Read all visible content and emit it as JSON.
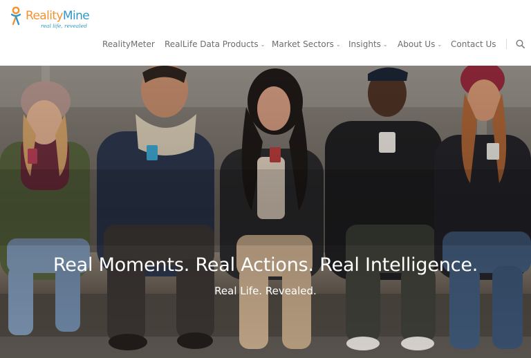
{
  "brand": {
    "name_part1": "Reality",
    "name_part2": "Mine",
    "tagline": "real life, revealed",
    "colors": {
      "orange": "#f2932f",
      "blue": "#2e97c5"
    }
  },
  "nav": {
    "items": [
      {
        "label": "RealityMeter",
        "has_dropdown": false
      },
      {
        "label": "RealLife Data Products",
        "has_dropdown": true
      },
      {
        "label": "Market Sectors",
        "has_dropdown": true
      },
      {
        "label": "Insights",
        "has_dropdown": true
      },
      {
        "label": "About Us",
        "has_dropdown": true
      },
      {
        "label": "Contact Us",
        "has_dropdown": false
      }
    ],
    "dropdown_icon": "chevron-down-icon",
    "search_icon": "search-icon"
  },
  "hero": {
    "headline": "Real Moments. Real Actions. Real Intelligence.",
    "subheadline": "Real Life. Revealed.",
    "image_subject": "five young people sitting on a stone ledge looking at smartphones"
  }
}
